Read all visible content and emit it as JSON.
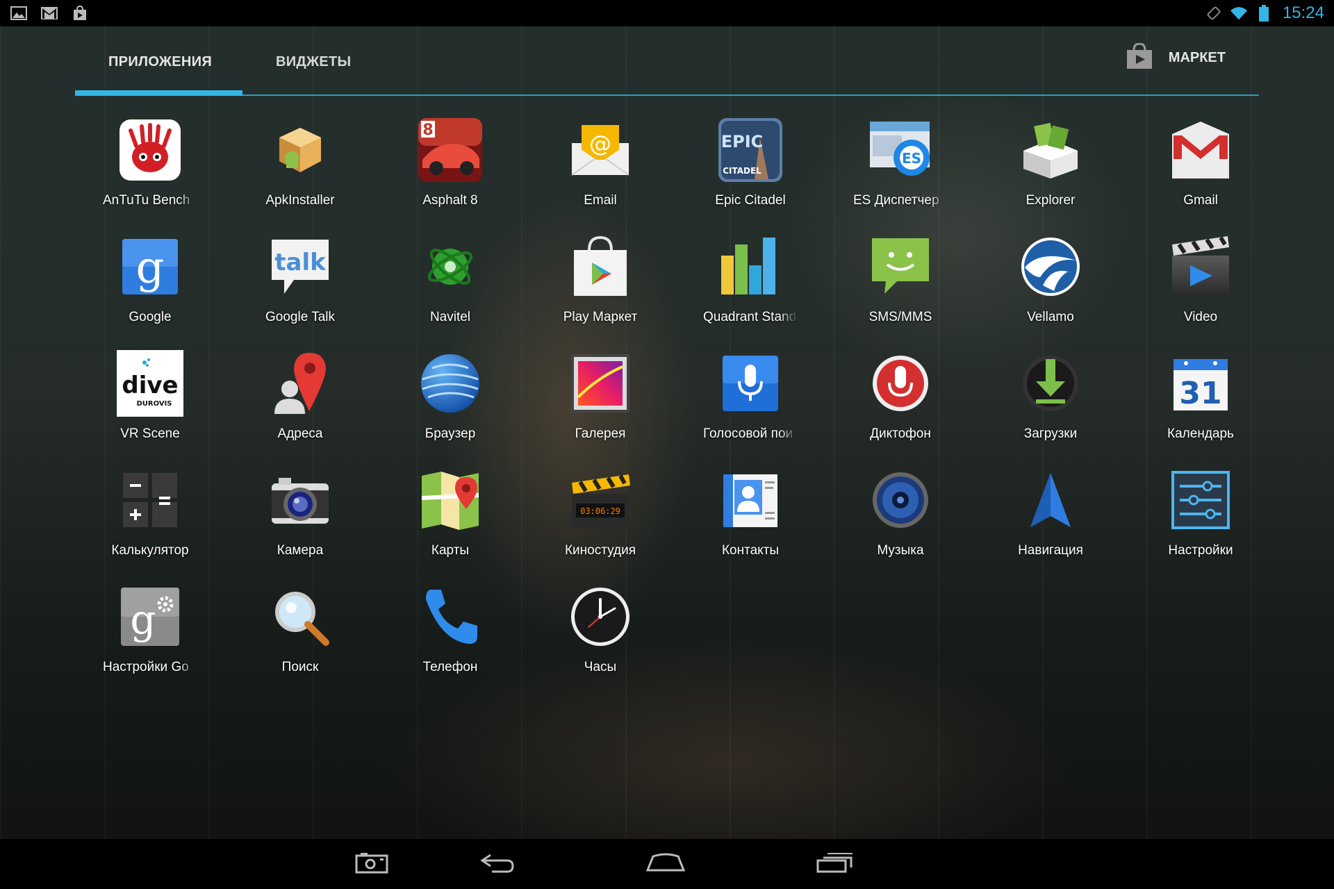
{
  "status_bar": {
    "left_icons": [
      "gallery-icon",
      "gmail-icon",
      "play-store-notification-icon"
    ],
    "right_icons": [
      "screen-rotation-icon",
      "wifi-icon",
      "battery-icon"
    ],
    "time": "15:24"
  },
  "tabs": [
    {
      "label": "ПРИЛОЖЕНИЯ",
      "selected": true
    },
    {
      "label": "ВИДЖЕТЫ",
      "selected": false
    }
  ],
  "market": {
    "label": "МАРКЕТ",
    "icon": "market-bag-icon"
  },
  "apps": [
    {
      "label": "AnTuTu Bench",
      "icon": "antutu-icon",
      "truncated": true
    },
    {
      "label": "ApkInstaller",
      "icon": "apkinstaller-icon"
    },
    {
      "label": "Asphalt 8",
      "icon": "asphalt-icon"
    },
    {
      "label": "Email",
      "icon": "email-icon"
    },
    {
      "label": "Epic Citadel",
      "icon": "epic-citadel-icon"
    },
    {
      "label": "ES Диспетчер",
      "icon": "es-explorer-icon",
      "truncated": true
    },
    {
      "label": "Explorer",
      "icon": "explorer-icon"
    },
    {
      "label": "Gmail",
      "icon": "gmail-icon"
    },
    {
      "label": "Google",
      "icon": "google-search-icon"
    },
    {
      "label": "Google Talk",
      "icon": "talk-icon"
    },
    {
      "label": "Navitel",
      "icon": "navitel-icon"
    },
    {
      "label": "Play Маркет",
      "icon": "play-market-icon"
    },
    {
      "label": "Quadrant Stand",
      "icon": "quadrant-icon",
      "truncated": true
    },
    {
      "label": "SMS/MMS",
      "icon": "sms-icon"
    },
    {
      "label": "Vellamo",
      "icon": "vellamo-icon"
    },
    {
      "label": "Video",
      "icon": "video-icon"
    },
    {
      "label": "VR Scene",
      "icon": "dive-icon"
    },
    {
      "label": "Адреса",
      "icon": "addresses-icon"
    },
    {
      "label": "Браузер",
      "icon": "browser-icon"
    },
    {
      "label": "Галерея",
      "icon": "gallery-icon"
    },
    {
      "label": "Голосовой пои",
      "icon": "voice-search-icon",
      "truncated": true
    },
    {
      "label": "Диктофон",
      "icon": "recorder-icon"
    },
    {
      "label": "Загрузки",
      "icon": "downloads-icon"
    },
    {
      "label": "Календарь",
      "icon": "calendar-icon"
    },
    {
      "label": "Калькулятор",
      "icon": "calculator-icon"
    },
    {
      "label": "Камера",
      "icon": "camera-icon"
    },
    {
      "label": "Карты",
      "icon": "maps-icon"
    },
    {
      "label": "Киностудия",
      "icon": "movie-studio-icon"
    },
    {
      "label": "Контакты",
      "icon": "contacts-icon"
    },
    {
      "label": "Музыка",
      "icon": "music-icon"
    },
    {
      "label": "Навигация",
      "icon": "navigation-icon"
    },
    {
      "label": "Настройки",
      "icon": "settings-icon"
    },
    {
      "label": "Настройки Go",
      "icon": "google-settings-icon",
      "truncated": true
    },
    {
      "label": "Поиск",
      "icon": "search-icon"
    },
    {
      "label": "Телефон",
      "icon": "phone-icon"
    },
    {
      "label": "Часы",
      "icon": "clock-icon"
    }
  ],
  "icon_text": {
    "asphalt_badge": "8",
    "dive_brand": "dive",
    "dive_sub": "DUROVIS",
    "epic_line1": "EPIC",
    "epic_line2": "CITADEL",
    "es_badge": "ES",
    "talk_text": "talk",
    "google_g": "g",
    "calendar_day": "31",
    "movie_timecode": "03:06:29",
    "gsettings_g": "g"
  },
  "nav_bar": {
    "buttons": [
      "screenshot-icon",
      "back-icon",
      "home-icon",
      "recent-apps-icon"
    ]
  },
  "colors": {
    "accent": "#33b5e5",
    "status_bar_bg": "#000000",
    "nav_bar_bg": "#000000"
  }
}
